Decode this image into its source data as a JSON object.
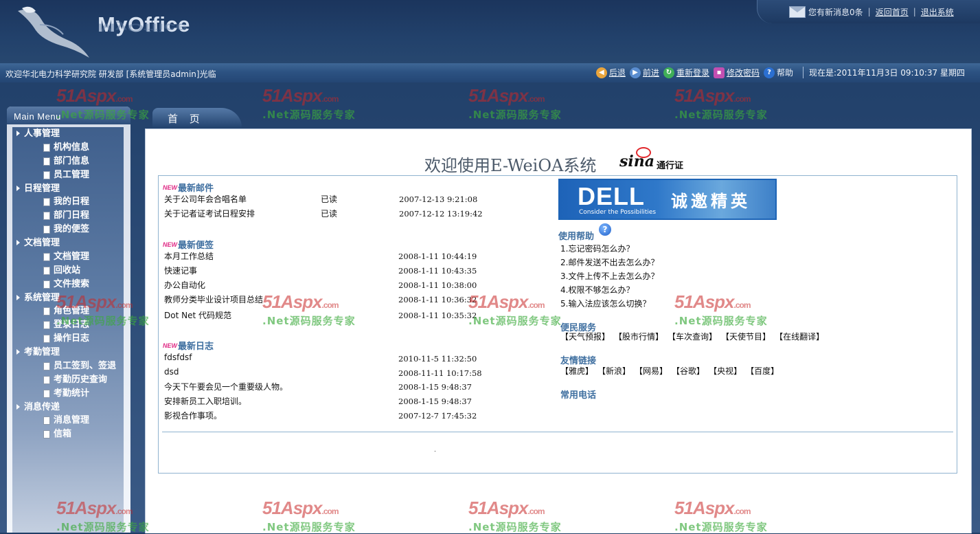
{
  "header": {
    "logo_text": "MyOffice",
    "logo_reflection": "MyOffice",
    "messages_text": "您有新消息0条",
    "home_link": "返回首页",
    "logout_link": "退出系统",
    "separator": "|"
  },
  "toolbar": {
    "welcome": "欢迎华北电力科学研究院  研发部  [系统管理员admin]光临",
    "back": "后退",
    "forward": "前进",
    "relogin": "重新登录",
    "change_password": "修改密码",
    "help": "帮助",
    "clock": "现在是:2011年11月3日  09:10:37 星期四"
  },
  "sidebar": {
    "title": "Main Menu",
    "groups": [
      {
        "label": "人事管理",
        "items": [
          "机构信息",
          "部门信息",
          "员工管理"
        ]
      },
      {
        "label": "日程管理",
        "items": [
          "我的日程",
          "部门日程",
          "我的便签"
        ]
      },
      {
        "label": "文档管理",
        "items": [
          "文档管理",
          "回收站",
          "文件搜索"
        ]
      },
      {
        "label": "系统管理",
        "items": [
          "角色管理",
          "登录日志",
          "操作日志"
        ]
      },
      {
        "label": "考勤管理",
        "items": [
          "员工签到、签退",
          "考勤历史查询",
          "考勤统计"
        ]
      },
      {
        "label": "消息传递",
        "items": [
          "消息管理",
          "信箱"
        ]
      }
    ]
  },
  "tab": {
    "label": "首 页"
  },
  "main": {
    "title": "欢迎使用E-WeiOA系统",
    "sina_word": "sina",
    "sina_pass": "通行证",
    "new_badge": "NEW",
    "mail": {
      "title": "最新邮件",
      "rows": [
        {
          "title": "关于公司年会合唱名单",
          "status": "已读",
          "time": "2007-12-13 9:21:08"
        },
        {
          "title": "关于记者证考试日程安排",
          "status": "已读",
          "time": "2007-12-12 13:19:42"
        }
      ]
    },
    "notes": {
      "title": "最新便签",
      "rows": [
        {
          "title": "本月工作总结",
          "time": "2008-1-11 10:44:19"
        },
        {
          "title": "快速记事",
          "time": "2008-1-11 10:43:35"
        },
        {
          "title": "办公自动化",
          "time": "2008-1-11 10:38:00"
        },
        {
          "title": "教师分类毕业设计项目总结",
          "time": "2008-1-11 10:36:32"
        },
        {
          "title": "Dot Net 代码规范",
          "time": "2008-1-11 10:35:32"
        }
      ]
    },
    "logs": {
      "title": "最新日志",
      "rows": [
        {
          "title": "fdsfdsf",
          "time": "2010-11-5 11:32:50"
        },
        {
          "title": "dsd",
          "time": "2008-11-11 10:17:58"
        },
        {
          "title": "今天下午要会见一个重要级人物。",
          "time": "2008-1-15 9:48:37"
        },
        {
          "title": "安排新员工入职培训。",
          "time": "2008-1-15 9:48:37"
        },
        {
          "title": "影视合作事项。",
          "time": "2007-12-7 17:45:32"
        }
      ]
    },
    "banner": {
      "brand": "DELL",
      "tagline": "Consider the Possibilities",
      "slogan": "诚邀精英"
    },
    "help": {
      "title": "使用帮助",
      "icon_glyph": "?",
      "items": [
        "1.忘记密码怎么办？",
        "2.邮件发送不出去怎么办？",
        "3.文件上传不上去怎么办？",
        "4.权限不够怎么办？",
        "5.输入法应该怎么切换？"
      ]
    },
    "services": {
      "title": "便民服务",
      "links": [
        "【天气预报】",
        "【股市行情】",
        "【车次查询】",
        "【天使节目】",
        "【在线翻译】"
      ]
    },
    "friends": {
      "title": "友情链接",
      "links": [
        "【雅虎】",
        "【新浪】",
        "【网易】",
        "【谷歌】",
        "【央视】",
        "【百度】"
      ]
    },
    "phones": {
      "title": "常用电话"
    }
  },
  "watermark": {
    "logo": "51Aspx",
    "domain": ".com",
    "sub": ".Net源码服务专家"
  },
  "colors": {
    "header_bg": "#1f3d66",
    "section_title": "#3f6fa0",
    "box_border": "#8fb3cf"
  }
}
